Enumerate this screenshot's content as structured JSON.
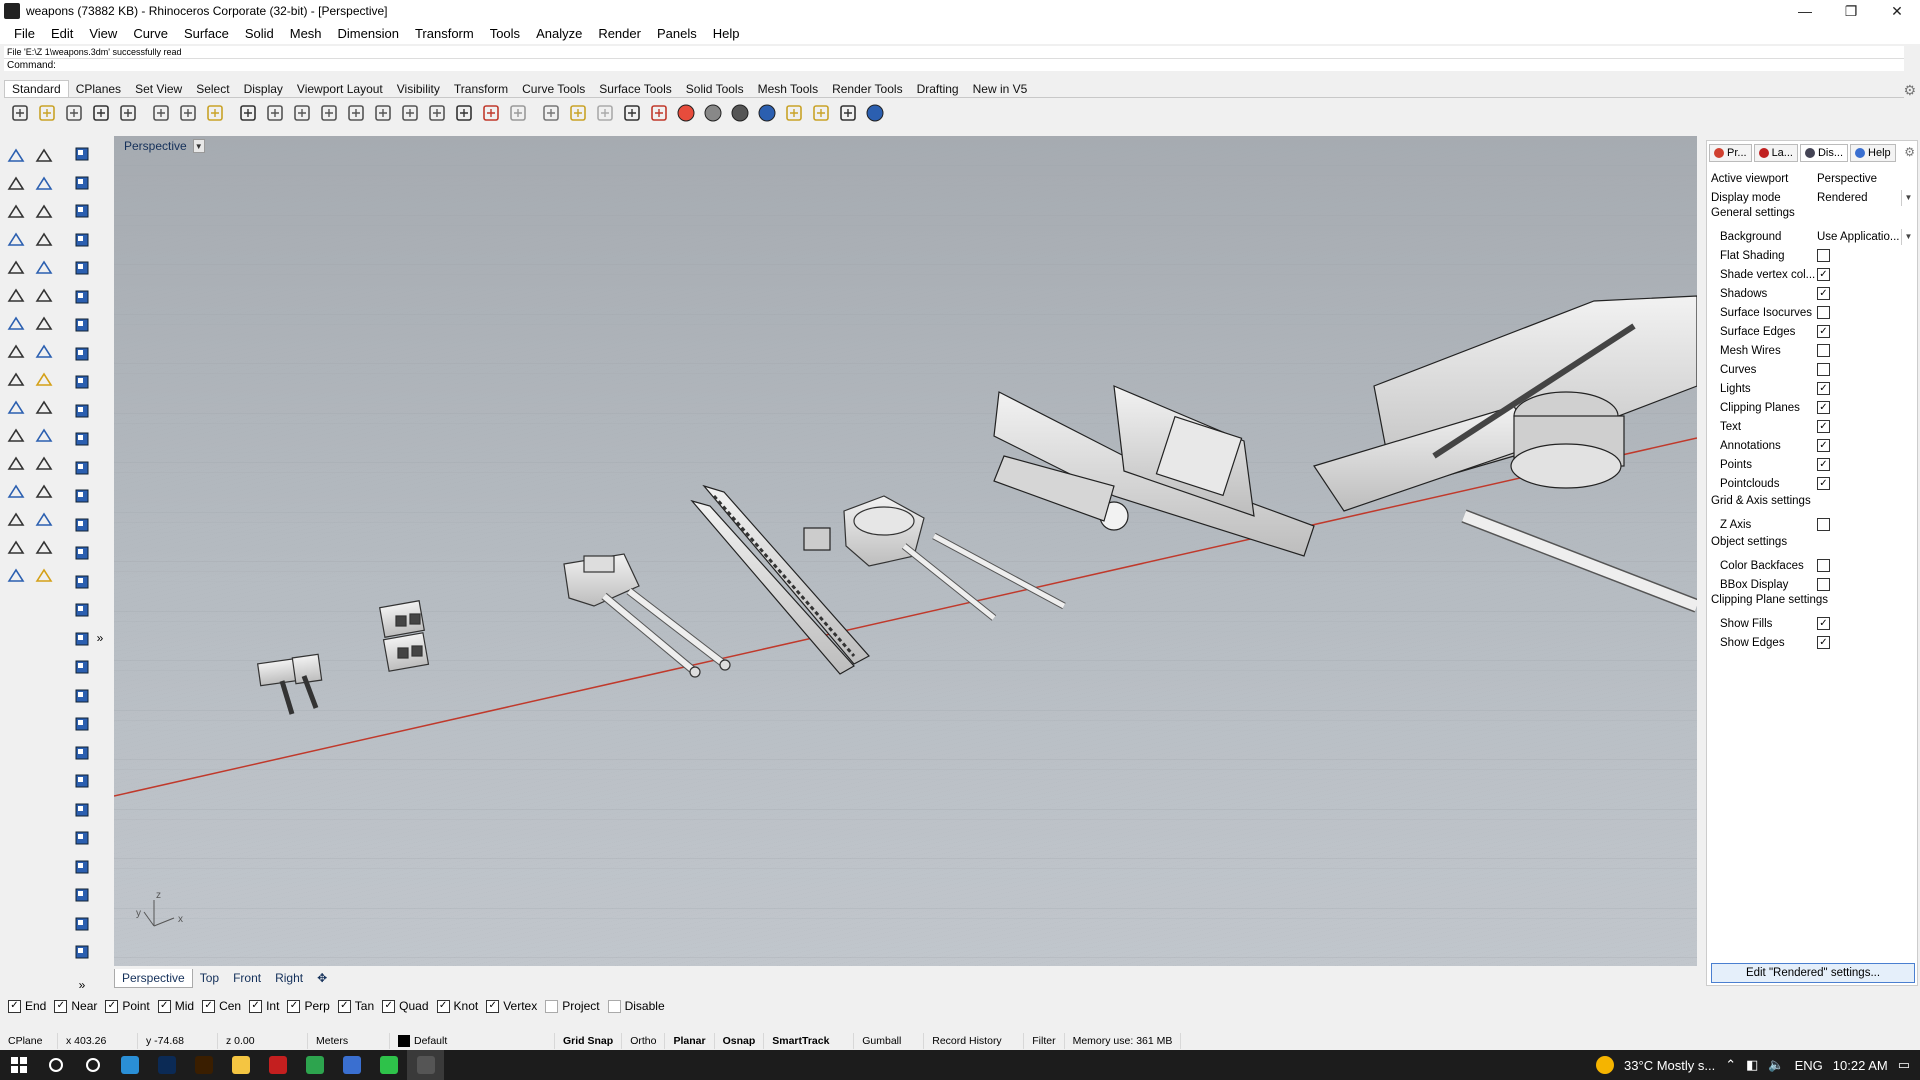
{
  "window": {
    "title": "weapons (73882 KB) - Rhinoceros Corporate (32-bit) - [Perspective]",
    "minimize": "—",
    "maximize": "❐",
    "close": "✕"
  },
  "menu": [
    "File",
    "Edit",
    "View",
    "Curve",
    "Surface",
    "Solid",
    "Mesh",
    "Dimension",
    "Transform",
    "Tools",
    "Analyze",
    "Render",
    "Panels",
    "Help"
  ],
  "command": {
    "history": "File 'E:\\Z 1\\weapons.3dm' successfully read",
    "prompt": "Command:",
    "value": ""
  },
  "toolbar_tabs": [
    "Standard",
    "CPlanes",
    "Set View",
    "Select",
    "Display",
    "Viewport Layout",
    "Visibility",
    "Transform",
    "Curve Tools",
    "Surface Tools",
    "Solid Tools",
    "Mesh Tools",
    "Render Tools",
    "Drafting",
    "New in V5"
  ],
  "toolbar_icons": [
    "new-file",
    "open-folder",
    "save",
    "print",
    "import",
    "cut",
    "copy",
    "paste",
    "undo",
    "pan-hand",
    "move-view",
    "zoom",
    "zoom-extents",
    "zoom-window",
    "zoom-selected",
    "rotate-view",
    "four-viewports",
    "car",
    "light-bulb-off",
    "target",
    "snap-points",
    "bulb",
    "lock",
    "layer-stack",
    "color-wheel",
    "sphere-gray",
    "sphere-shaded",
    "sphere-blue",
    "select-pen",
    "gear-tool",
    "grid-tool",
    "help"
  ],
  "viewport": {
    "label": "Perspective",
    "tabs": [
      "Perspective",
      "Top",
      "Front",
      "Right"
    ],
    "active_tab": "Perspective",
    "axis_z": "z",
    "axis_y": "y",
    "axis_x": "x"
  },
  "panel": {
    "tabs": [
      {
        "label": "Pr...",
        "color": "#d04030"
      },
      {
        "label": "La...",
        "color": "#c02020"
      },
      {
        "label": "Dis...",
        "color": "#445"
      },
      {
        "label": "Help",
        "color": "#3a6fd0"
      }
    ],
    "active_viewport_label": "Active viewport",
    "active_viewport_value": "Perspective",
    "display_mode_label": "Display mode",
    "display_mode_value": "Rendered",
    "general_settings": "General settings",
    "background_label": "Background",
    "background_value": "Use Applicatio...",
    "general_rows": [
      {
        "label": "Flat Shading",
        "checked": false
      },
      {
        "label": "Shade vertex col...",
        "checked": true
      },
      {
        "label": "Shadows",
        "checked": true
      },
      {
        "label": "Surface Isocurves",
        "checked": false
      },
      {
        "label": "Surface Edges",
        "checked": true
      },
      {
        "label": "Mesh Wires",
        "checked": false
      },
      {
        "label": "Curves",
        "checked": false
      },
      {
        "label": "Lights",
        "checked": true
      },
      {
        "label": "Clipping Planes",
        "checked": true
      },
      {
        "label": "Text",
        "checked": true
      },
      {
        "label": "Annotations",
        "checked": true
      },
      {
        "label": "Points",
        "checked": true
      },
      {
        "label": "Pointclouds",
        "checked": true
      }
    ],
    "grid_settings": "Grid & Axis settings",
    "grid_rows": [
      {
        "label": "Z Axis",
        "checked": false
      }
    ],
    "object_settings": "Object settings",
    "object_rows": [
      {
        "label": "Color Backfaces",
        "checked": false
      },
      {
        "label": "BBox Display",
        "checked": false
      }
    ],
    "clip_settings": "Clipping Plane settings",
    "clip_rows": [
      {
        "label": "Show Fills",
        "checked": true
      },
      {
        "label": "Show Edges",
        "checked": true
      }
    ],
    "edit_button": "Edit \"Rendered\" settings..."
  },
  "osnaps": [
    {
      "label": "End",
      "checked": true
    },
    {
      "label": "Near",
      "checked": true
    },
    {
      "label": "Point",
      "checked": true
    },
    {
      "label": "Mid",
      "checked": true
    },
    {
      "label": "Cen",
      "checked": true
    },
    {
      "label": "Int",
      "checked": true
    },
    {
      "label": "Perp",
      "checked": true
    },
    {
      "label": "Tan",
      "checked": true
    },
    {
      "label": "Quad",
      "checked": true
    },
    {
      "label": "Knot",
      "checked": true
    },
    {
      "label": "Vertex",
      "checked": true
    },
    {
      "label": "Project",
      "checked": false
    },
    {
      "label": "Disable",
      "checked": false
    }
  ],
  "status": {
    "cplane": "CPlane",
    "x": "x 403.26",
    "y": "y -74.68",
    "z": "z 0.00",
    "units": "Meters",
    "layer": "Default",
    "grid_snap": "Grid Snap",
    "ortho": "Ortho",
    "planar": "Planar",
    "osnap": "Osnap",
    "smarttrack": "SmartTrack",
    "gumball": "Gumball",
    "record_history": "Record History",
    "filter": "Filter",
    "memory": "Memory use: 361 MB"
  },
  "taskbar": {
    "weather": "33°C  Mostly s...",
    "lang": "ENG",
    "time": "10:22 AM",
    "apps": [
      {
        "name": "search",
        "color": "#1c1c1c"
      },
      {
        "name": "task-view",
        "color": "#1c1c1c"
      },
      {
        "name": "edge",
        "color": "#2a8fd6"
      },
      {
        "name": "photoshop",
        "color": "#0b2a55"
      },
      {
        "name": "illustrator",
        "color": "#3a1e00"
      },
      {
        "name": "file-explorer",
        "color": "#f4c542"
      },
      {
        "name": "acrobat",
        "color": "#c41f1f"
      },
      {
        "name": "chrome",
        "color": "#2da44e"
      },
      {
        "name": "app-blue",
        "color": "#3a6fd0"
      },
      {
        "name": "line",
        "color": "#2ec24a"
      },
      {
        "name": "rhino",
        "color": "#555"
      }
    ]
  }
}
